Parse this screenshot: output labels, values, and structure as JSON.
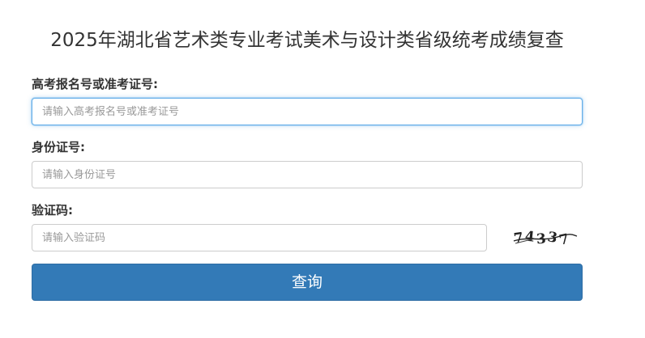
{
  "title": "2025年湖北省艺术类专业考试美术与设计类省级统考成绩复查",
  "form": {
    "exam_id": {
      "label": "高考报名号或准考证号:",
      "placeholder": "请输入高考报名号或准考证号",
      "value": ""
    },
    "id_card": {
      "label": "身份证号:",
      "placeholder": "请输入身份证号",
      "value": ""
    },
    "captcha": {
      "label": "验证码:",
      "placeholder": "请输入验证码",
      "value": "",
      "image_text": "74337"
    },
    "submit_label": "查询"
  },
  "colors": {
    "button_bg": "#337ab7",
    "focus_border": "#66afe9",
    "input_border": "#cccccc"
  }
}
